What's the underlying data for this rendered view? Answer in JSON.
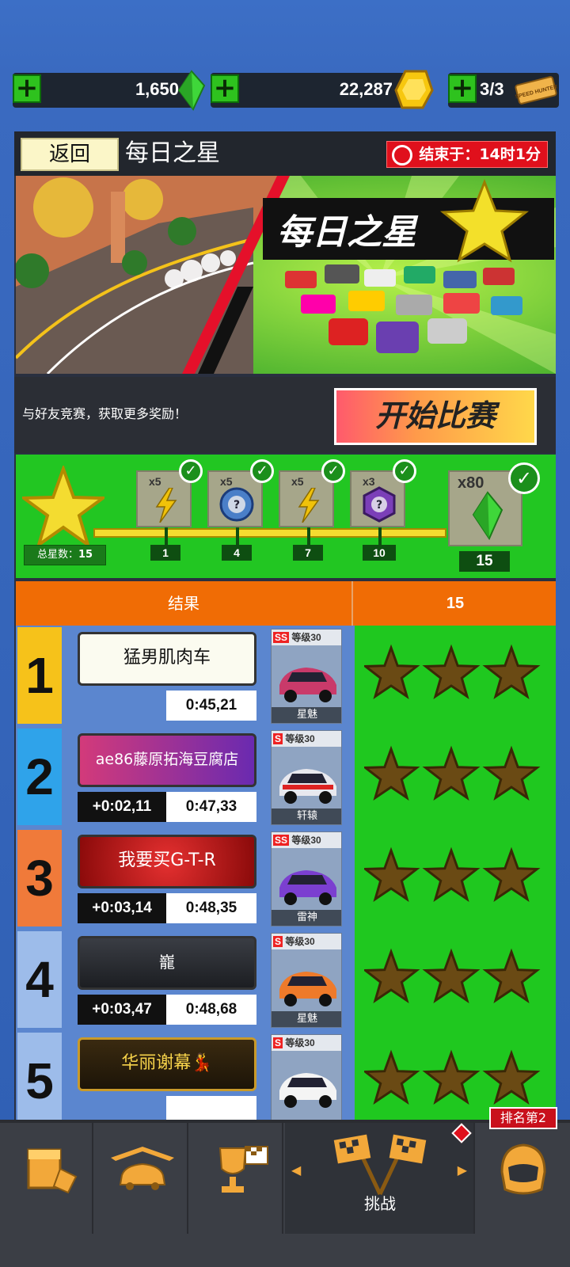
{
  "currencies": [
    {
      "value": "1,650",
      "icon": "green-gem-icon"
    },
    {
      "value": "22,287",
      "icon": "gold-coin-icon"
    },
    {
      "value": "3/3",
      "icon": "speed-hunter-ticket-icon",
      "ticket_text": "SPEED HUNTER"
    }
  ],
  "header": {
    "back_label": "返回",
    "title": "每日之星",
    "timer_label": "结束于：",
    "timer_value": "14时1分"
  },
  "banner": {
    "title": "每日之星"
  },
  "sub": {
    "text": "与好友竞赛，获取更多奖励！",
    "start_label": "开始比赛"
  },
  "progress": {
    "total_label": "总星数：",
    "total_value": "15",
    "rewards": [
      {
        "count": "x5",
        "icon": "lightning-icon",
        "milestone": "1"
      },
      {
        "count": "x5",
        "icon": "mystery-blue-icon",
        "milestone": "4"
      },
      {
        "count": "x5",
        "icon": "lightning-icon",
        "milestone": "7"
      },
      {
        "count": "x3",
        "icon": "mystery-purple-icon",
        "milestone": "10"
      },
      {
        "count": "x80",
        "icon": "green-gem-icon",
        "milestone": "15"
      }
    ]
  },
  "tabs": {
    "results": "结果",
    "score": "15"
  },
  "rows": [
    {
      "rank": "1",
      "name": "猛男肌肉车",
      "gap": "",
      "time": "0:45,21",
      "class": "SS",
      "level": "等级30",
      "car": "星魅",
      "stars": 1,
      "rank_color": "#f6c21a",
      "plate": "white"
    },
    {
      "rank": "2",
      "name": "ae86藤原拓海豆腐店",
      "gap": "+0:02,11",
      "time": "0:47,33",
      "class": "S",
      "level": "等级30",
      "car": "轩辕",
      "stars": 1,
      "rank_color": "#2fa3ea",
      "plate": "purple"
    },
    {
      "rank": "3",
      "name": "我要买G-T-R",
      "gap": "+0:03,14",
      "time": "0:48,35",
      "class": "SS",
      "level": "等级30",
      "car": "雷神",
      "stars": 1,
      "rank_color": "#f07a3a",
      "plate": "red"
    },
    {
      "rank": "4",
      "name": "巃",
      "gap": "+0:03,47",
      "time": "0:48,68",
      "class": "S",
      "level": "等级30",
      "car": "星魅",
      "stars": 1,
      "rank_color": "#9dbcea",
      "plate": "dark"
    },
    {
      "rank": "5",
      "name": "华丽谢幕💃",
      "gap": "",
      "time": "",
      "class": "S",
      "level": "等级30",
      "car": "",
      "stars": 1,
      "rank_color": "#9dbcea",
      "plate": "gold"
    }
  ],
  "nav": {
    "challenge_label": "挑战",
    "rank_badge": "排名第2"
  },
  "colors": {
    "accent_green": "#1fc81f",
    "orange": "#f06c05",
    "red": "#e0101c"
  }
}
